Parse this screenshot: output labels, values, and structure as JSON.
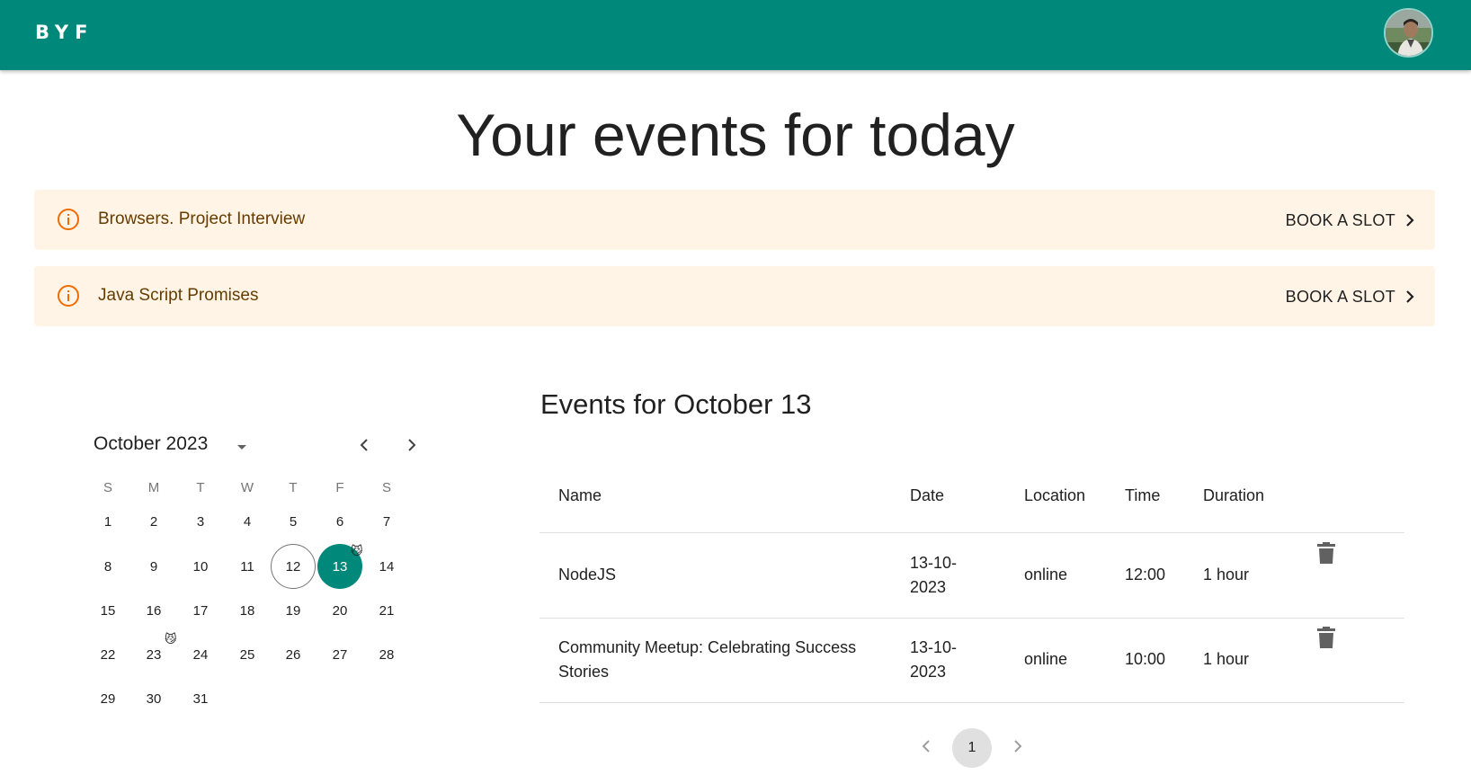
{
  "header": {
    "logo": "BYF",
    "accent_color": "#00897b",
    "avatar_icon": "user-avatar"
  },
  "page_title": "Your events for today",
  "alerts": [
    {
      "icon": "info-icon",
      "text": "Browsers. Project Interview",
      "action": "BOOK A SLOT"
    },
    {
      "icon": "info-icon",
      "text": "Java Script Promises",
      "action": "BOOK A SLOT"
    }
  ],
  "calendar": {
    "month_label": "October 2023",
    "weekdays": [
      "S",
      "M",
      "T",
      "W",
      "T",
      "F",
      "S"
    ],
    "weeks": [
      [
        "1",
        "2",
        "3",
        "4",
        "5",
        "6",
        "7"
      ],
      [
        "8",
        "9",
        "10",
        "11",
        "12",
        "13",
        "14"
      ],
      [
        "15",
        "16",
        "17",
        "18",
        "19",
        "20",
        "21"
      ],
      [
        "22",
        "23",
        "24",
        "25",
        "26",
        "27",
        "28"
      ],
      [
        "29",
        "30",
        "31"
      ]
    ],
    "today": "12",
    "selected": "13",
    "days_with_badge": [
      "13",
      "23"
    ],
    "badge_emoji": "😼"
  },
  "events": {
    "title": "Events for October 13",
    "columns": [
      "Name",
      "Date",
      "Location",
      "Time",
      "Duration"
    ],
    "rows": [
      {
        "name": "NodeJS",
        "date_line1": "13-10-",
        "date_line2": "2023",
        "location": "online",
        "time": "12:00",
        "duration": "1 hour"
      },
      {
        "name_line1": "Community Meetup: Celebrating Success",
        "name_line2": "Stories",
        "date_line1": "13-10-",
        "date_line2": "2023",
        "location": "online",
        "time": "10:00",
        "duration": "1 hour"
      }
    ]
  },
  "pagination": {
    "current_page": "1"
  }
}
